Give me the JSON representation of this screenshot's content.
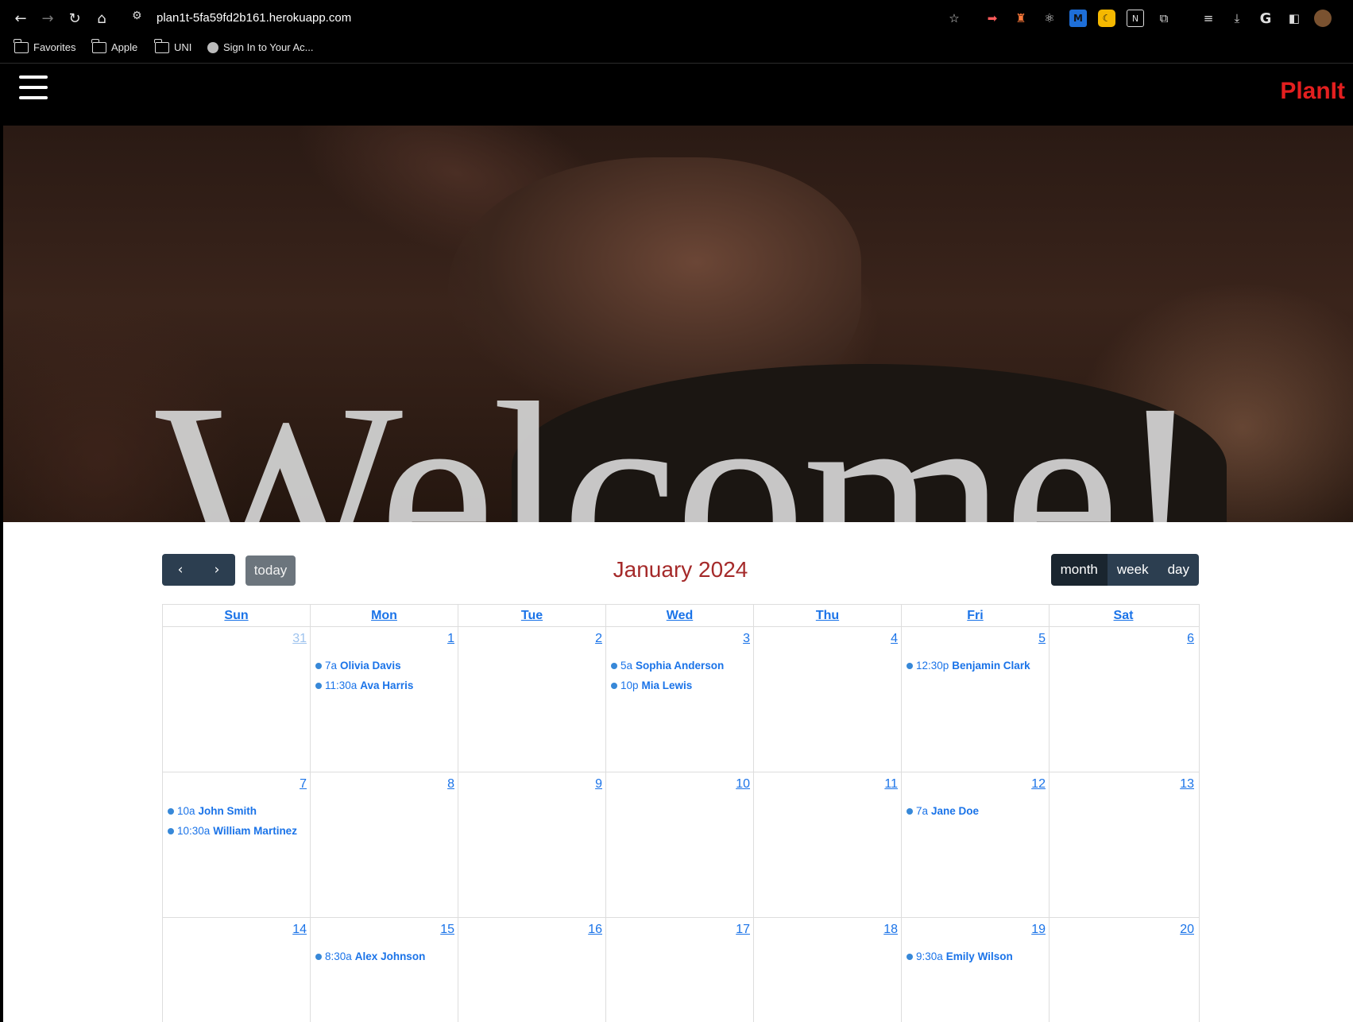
{
  "browser": {
    "url": "plan1t-5fa59fd2b161.herokuapp.com",
    "bookmarks": [
      "Favorites",
      "Apple",
      "UNI",
      "Sign In to Your Ac..."
    ]
  },
  "navbar": {
    "brand": "PlanIt"
  },
  "hero": {
    "heading": "Welcome!"
  },
  "calendar": {
    "title": "January 2024",
    "today_label": "today",
    "views": [
      "month",
      "week",
      "day"
    ],
    "active_view": "month",
    "weekdays": [
      "Sun",
      "Mon",
      "Tue",
      "Wed",
      "Thu",
      "Fri",
      "Sat"
    ],
    "weeks": [
      [
        {
          "day": "31",
          "other": true,
          "events": []
        },
        {
          "day": "1",
          "events": [
            {
              "time": "7a",
              "title": "Olivia Davis"
            },
            {
              "time": "11:30a",
              "title": "Ava Harris"
            }
          ]
        },
        {
          "day": "2",
          "events": []
        },
        {
          "day": "3",
          "events": [
            {
              "time": "5a",
              "title": "Sophia Anderson"
            },
            {
              "time": "10p",
              "title": "Mia Lewis"
            }
          ]
        },
        {
          "day": "4",
          "events": []
        },
        {
          "day": "5",
          "events": [
            {
              "time": "12:30p",
              "title": "Benjamin Clark"
            }
          ]
        },
        {
          "day": "6",
          "events": []
        }
      ],
      [
        {
          "day": "7",
          "events": [
            {
              "time": "10a",
              "title": "John Smith"
            },
            {
              "time": "10:30a",
              "title": "William Martinez"
            }
          ]
        },
        {
          "day": "8",
          "events": []
        },
        {
          "day": "9",
          "events": []
        },
        {
          "day": "10",
          "events": []
        },
        {
          "day": "11",
          "events": []
        },
        {
          "day": "12",
          "events": [
            {
              "time": "7a",
              "title": "Jane Doe"
            }
          ]
        },
        {
          "day": "13",
          "events": []
        }
      ],
      [
        {
          "day": "14",
          "events": []
        },
        {
          "day": "15",
          "events": [
            {
              "time": "8:30a",
              "title": "Alex Johnson"
            }
          ]
        },
        {
          "day": "16",
          "events": []
        },
        {
          "day": "17",
          "events": []
        },
        {
          "day": "18",
          "events": []
        },
        {
          "day": "19",
          "events": [
            {
              "time": "9:30a",
              "title": "Emily Wilson"
            }
          ]
        },
        {
          "day": "20",
          "events": []
        }
      ]
    ]
  },
  "colors": {
    "brand": "#e41f1f",
    "title": "#a52a2a",
    "link": "#1a73e8",
    "event_dot": "#3788d8",
    "button": "#2c3e50"
  }
}
